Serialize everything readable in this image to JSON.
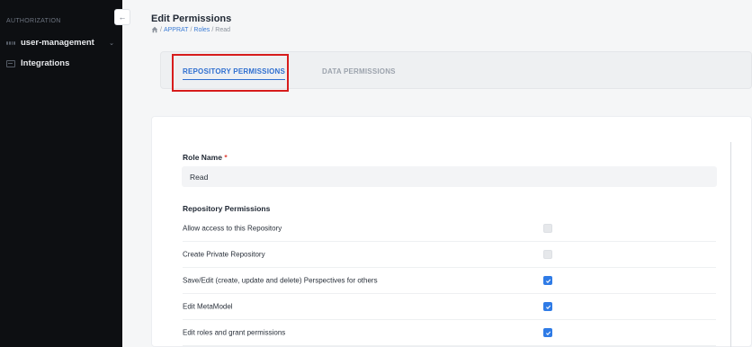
{
  "sidebar": {
    "section_label": "AUTHORIZATION",
    "collapse_icon": "←",
    "items": [
      {
        "label": "user-management",
        "icon": "grid-icon",
        "has_chevron": true
      },
      {
        "label": "Integrations",
        "icon": "integrations-icon",
        "has_chevron": false
      }
    ],
    "chevron": "⌄"
  },
  "header": {
    "title": "Edit Permissions",
    "breadcrumb": [
      "APPRAT",
      "Roles",
      "Read"
    ],
    "separator": "/"
  },
  "tabs": [
    {
      "label": "REPOSITORY PERMISSIONS",
      "active": true
    },
    {
      "label": "DATA PERMISSIONS",
      "active": false
    }
  ],
  "form": {
    "role_name_label": "Role Name",
    "required_mark": "*",
    "role_name_value": "Read",
    "section_title": "Repository Permissions",
    "permissions": [
      {
        "label": "Allow access to this Repository",
        "checked": false
      },
      {
        "label": "Create Private Repository",
        "checked": false
      },
      {
        "label": "Save/Edit (create, update and delete) Perspectives for others",
        "checked": true
      },
      {
        "label": "Edit MetaModel",
        "checked": true
      },
      {
        "label": "Edit roles and grant permissions",
        "checked": true
      }
    ]
  },
  "colors": {
    "accent": "#2f6fd0",
    "checkbox_on": "#2f7be6",
    "highlight": "#d71c1c",
    "sidebar_bg": "#0d0f12"
  }
}
